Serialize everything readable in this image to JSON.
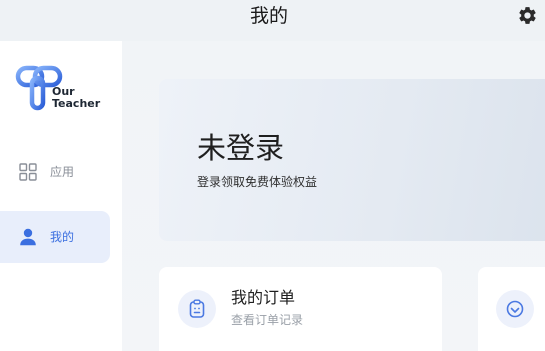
{
  "header": {
    "title": "我的",
    "settings_icon": "gear-icon"
  },
  "sidebar": {
    "logo": {
      "icon": "our-teacher-logo-icon",
      "line1": "Our",
      "line2": "Teacher"
    },
    "items": [
      {
        "label": "应用",
        "icon": "grid-icon",
        "active": false
      },
      {
        "label": "我的",
        "icon": "person-icon",
        "active": true
      }
    ]
  },
  "main": {
    "login_card": {
      "title": "未登录",
      "subtitle": "登录领取免费体验权益"
    },
    "cards": [
      {
        "title": "我的订单",
        "subtitle": "查看订单记录",
        "icon": "order-icon"
      },
      {
        "icon": "smile-icon"
      }
    ]
  },
  "colors": {
    "accent": "#3b6fe0",
    "active_item_bg": "#e8eefb",
    "icon_circle_bg": "#edf1fb",
    "page_bg": "#f2f5f8"
  }
}
